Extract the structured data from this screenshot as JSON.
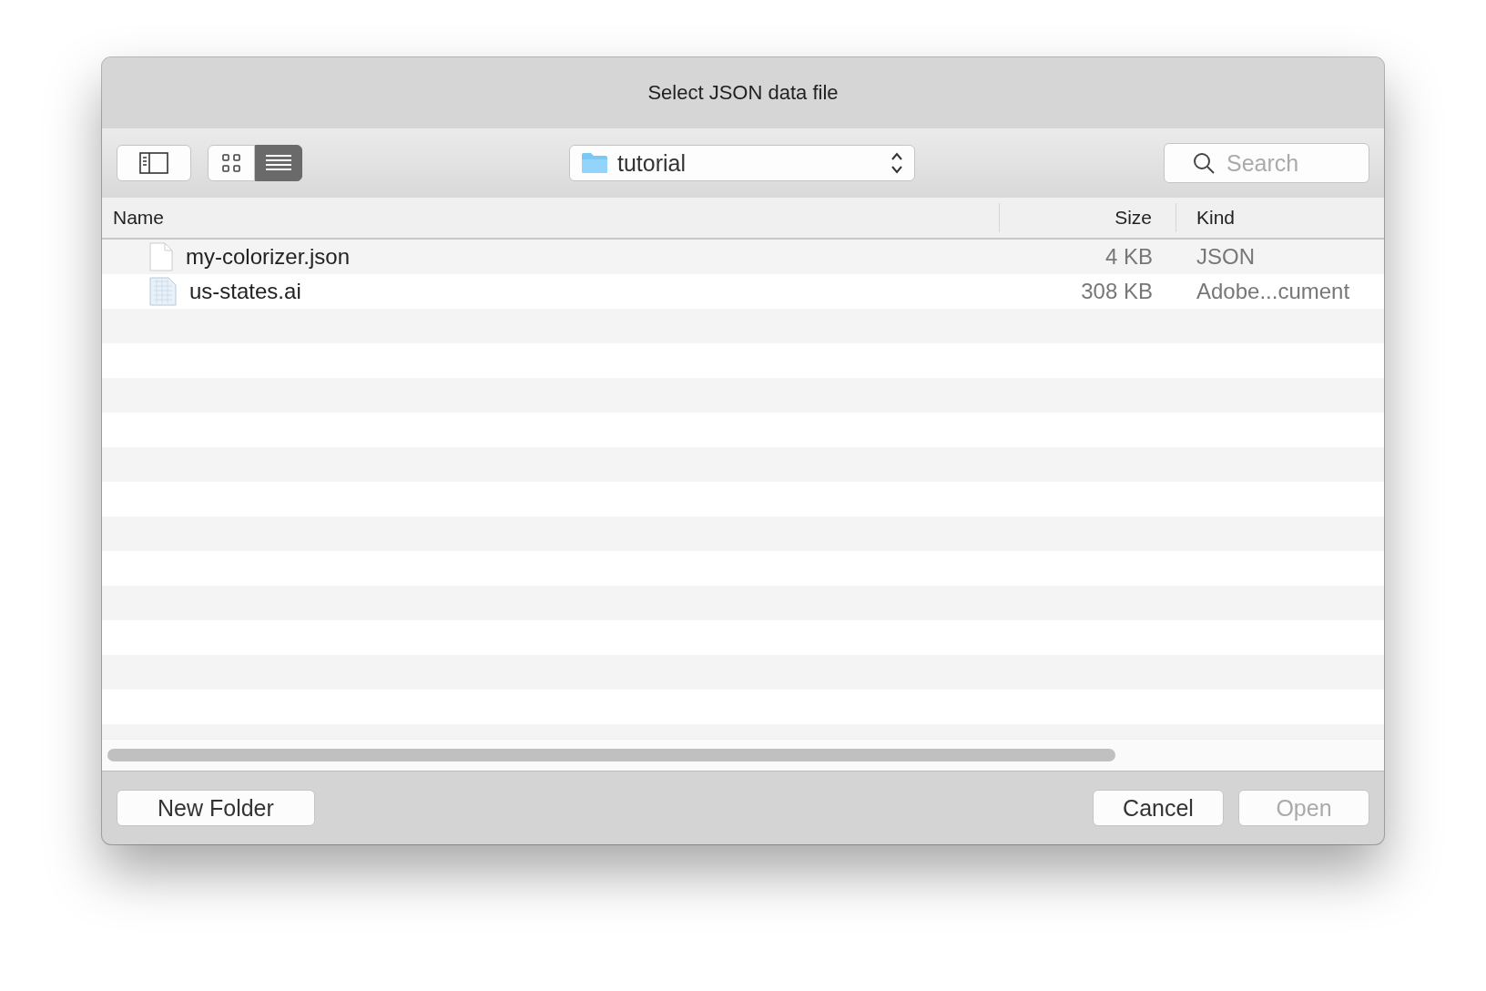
{
  "window": {
    "title": "Select JSON data file"
  },
  "toolbar": {
    "view_modes": [
      {
        "kind": "icons",
        "selected": false
      },
      {
        "kind": "list",
        "selected": true
      }
    ],
    "location": "tutorial",
    "search": {
      "placeholder": "Search"
    }
  },
  "table": {
    "columns": [
      "Name",
      "Size",
      "Kind"
    ],
    "rows": [
      {
        "kind": "document",
        "name": "my-colorizer.json",
        "size": "4 KB",
        "file_kind": "JSON"
      },
      {
        "kind": "illustration",
        "name": "us-states.ai",
        "size": "308 KB",
        "file_kind": "Adobe...cument"
      }
    ]
  },
  "buttons": [
    {
      "label": "New Folder",
      "disabled": false
    },
    {
      "label": "Cancel",
      "disabled": false
    },
    {
      "label": "Open",
      "disabled": true
    }
  ]
}
